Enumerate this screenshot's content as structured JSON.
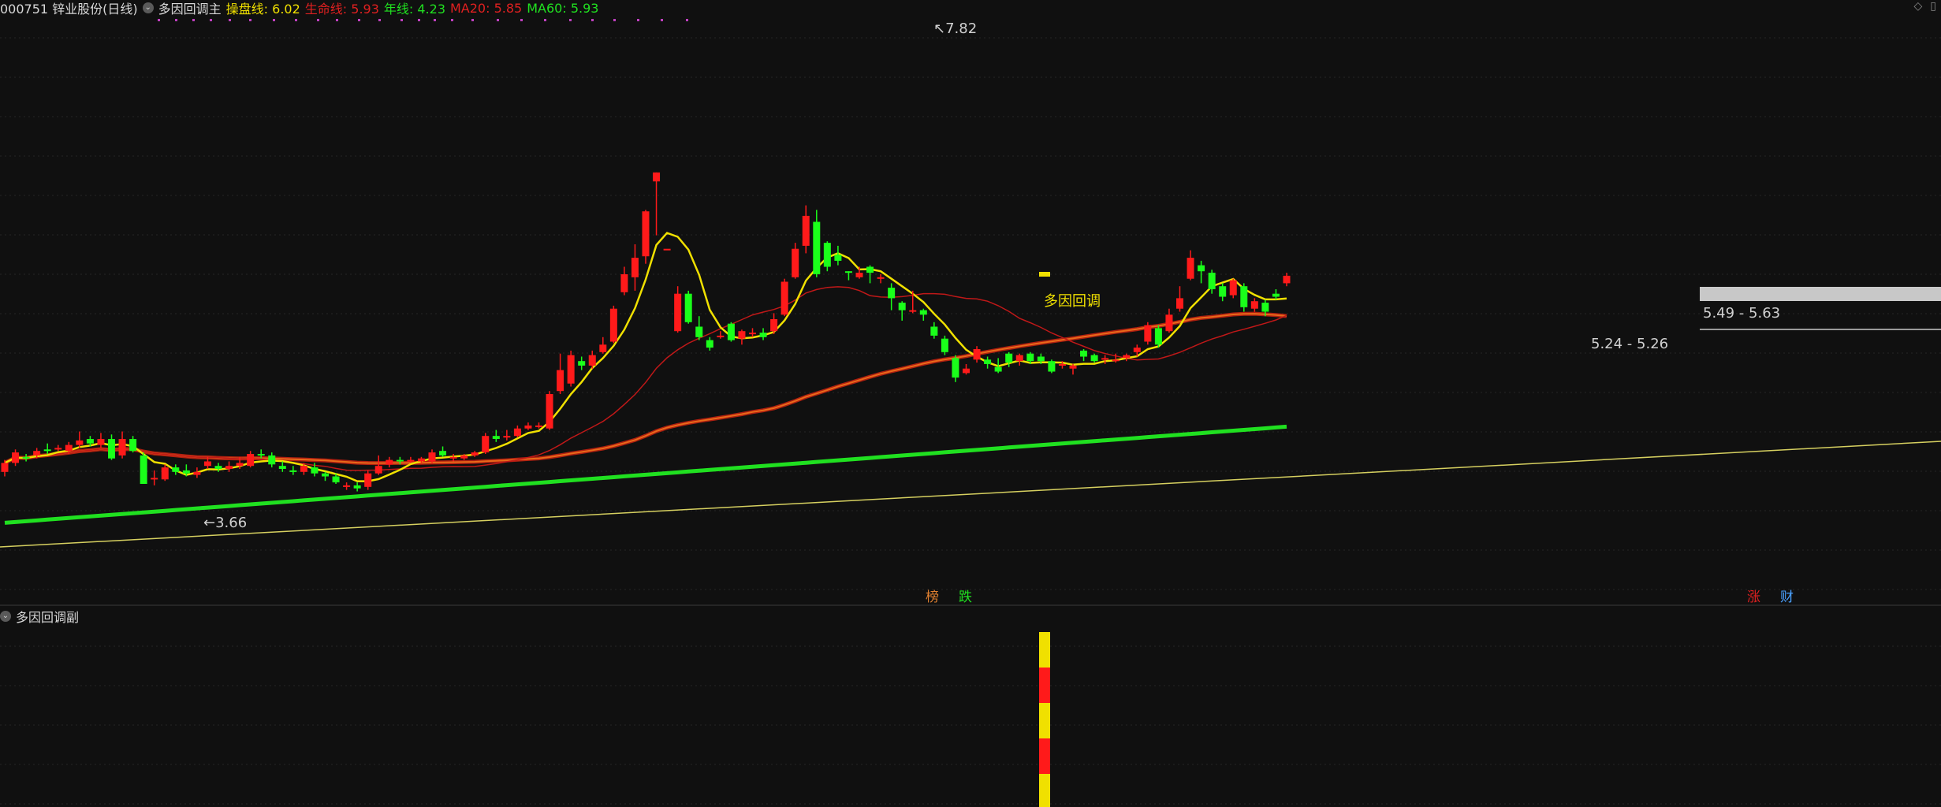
{
  "header": {
    "stock": "000751 锌业股份(日线)",
    "indicator": "多因回调主",
    "items": [
      {
        "label": "操盘线: ",
        "value": "6.02",
        "color": "#f0e000"
      },
      {
        "label": "生命线: ",
        "value": "5.93",
        "color": "#e02020"
      },
      {
        "label": "年线: ",
        "value": "4.23",
        "color": "#20e020"
      },
      {
        "label": "MA20: ",
        "value": "5.85",
        "color": "#e02020"
      },
      {
        "label": "MA60: ",
        "value": "5.93",
        "color": "#20e020"
      }
    ]
  },
  "sub_header": {
    "label": "多因回调副"
  },
  "annotations": {
    "high": "7.82",
    "low": "3.66",
    "signal": "多因回调",
    "zone1": "5.24 - 5.26",
    "zone2": "5.49 - 5.63"
  },
  "markers": [
    {
      "text": "榜",
      "color": "#e08030"
    },
    {
      "text": "跌",
      "color": "#20e020"
    },
    {
      "text": "涨",
      "color": "#e02020"
    },
    {
      "text": "财",
      "color": "#4aa0ff"
    }
  ],
  "colors": {
    "up": "#ff1a1a",
    "down": "#1aff1a",
    "trade_line": "#f0e000",
    "life_line": "#e86a1a",
    "year_line": "#20e020",
    "ma20": "#c01818"
  },
  "chart_data": {
    "type": "candlestick",
    "ylim": [
      3.0,
      8.0
    ],
    "candles": [
      [
        3.82,
        3.94,
        3.98,
        3.76
      ],
      [
        3.94,
        4.08,
        4.12,
        3.9
      ],
      [
        4.02,
        4.0,
        4.06,
        3.96
      ],
      [
        4.04,
        4.1,
        4.14,
        4.0
      ],
      [
        4.12,
        4.1,
        4.2,
        4.06
      ],
      [
        4.12,
        4.14,
        4.18,
        4.1
      ],
      [
        4.1,
        4.18,
        4.22,
        4.06
      ],
      [
        4.18,
        4.24,
        4.36,
        4.14
      ],
      [
        4.26,
        4.2,
        4.3,
        4.16
      ],
      [
        4.18,
        4.26,
        4.34,
        4.14
      ],
      [
        4.26,
        4.0,
        4.32,
        3.98
      ],
      [
        4.04,
        4.26,
        4.36,
        4.0
      ],
      [
        4.26,
        4.1,
        4.3,
        4.08
      ],
      [
        4.04,
        3.66,
        4.08,
        3.66
      ],
      [
        3.74,
        3.74,
        3.84,
        3.64
      ],
      [
        3.72,
        3.88,
        3.92,
        3.7
      ],
      [
        3.88,
        3.82,
        3.92,
        3.78
      ],
      [
        3.84,
        3.8,
        3.92,
        3.76
      ],
      [
        3.78,
        3.82,
        3.88,
        3.74
      ],
      [
        3.9,
        3.96,
        4.02,
        3.86
      ],
      [
        3.9,
        3.86,
        3.94,
        3.82
      ],
      [
        3.86,
        3.9,
        3.96,
        3.82
      ],
      [
        3.9,
        3.94,
        4.02,
        3.86
      ],
      [
        3.9,
        4.06,
        4.1,
        3.88
      ],
      [
        4.06,
        4.04,
        4.12,
        4.0
      ],
      [
        4.04,
        3.92,
        4.08,
        3.88
      ],
      [
        3.9,
        3.86,
        3.96,
        3.82
      ],
      [
        3.84,
        3.82,
        3.9,
        3.78
      ],
      [
        3.82,
        3.9,
        3.94,
        3.78
      ],
      [
        3.88,
        3.8,
        3.94,
        3.76
      ],
      [
        3.8,
        3.76,
        3.82,
        3.7
      ],
      [
        3.76,
        3.68,
        3.8,
        3.66
      ],
      [
        3.62,
        3.64,
        3.68,
        3.58
      ],
      [
        3.64,
        3.6,
        3.68,
        3.56
      ],
      [
        3.62,
        3.8,
        3.84,
        3.58
      ],
      [
        3.8,
        3.9,
        4.04,
        3.78
      ],
      [
        3.92,
        3.98,
        4.02,
        3.88
      ],
      [
        3.98,
        3.96,
        4.02,
        3.92
      ],
      [
        3.96,
        3.98,
        4.02,
        3.94
      ],
      [
        3.96,
        4.0,
        4.02,
        3.94
      ],
      [
        3.96,
        4.08,
        4.12,
        3.94
      ],
      [
        4.1,
        4.04,
        4.16,
        4.02
      ],
      [
        4.0,
        4.02,
        4.06,
        3.96
      ],
      [
        4.0,
        4.04,
        4.06,
        3.98
      ],
      [
        4.04,
        4.08,
        4.1,
        4.02
      ],
      [
        4.08,
        4.3,
        4.34,
        4.06
      ],
      [
        4.3,
        4.26,
        4.38,
        4.22
      ],
      [
        4.3,
        4.3,
        4.38,
        4.24
      ],
      [
        4.3,
        4.4,
        4.44,
        4.28
      ],
      [
        4.4,
        4.44,
        4.48,
        4.38
      ],
      [
        4.44,
        4.44,
        4.48,
        4.4
      ],
      [
        4.4,
        4.86,
        4.9,
        4.38
      ],
      [
        4.9,
        5.18,
        5.4,
        4.86
      ],
      [
        5.0,
        5.38,
        5.44,
        4.96
      ],
      [
        5.3,
        5.24,
        5.36,
        5.18
      ],
      [
        5.24,
        5.38,
        5.44,
        5.2
      ],
      [
        5.42,
        5.52,
        5.62,
        5.4
      ],
      [
        5.56,
        6.0,
        6.04,
        5.54
      ],
      [
        6.22,
        6.46,
        6.56,
        6.18
      ],
      [
        6.42,
        6.68,
        6.86,
        6.24
      ],
      [
        6.7,
        7.3,
        7.32,
        6.6
      ],
      [
        7.7,
        7.82,
        7.82,
        6.98
      ],
      [
        6.8,
        6.8,
        6.8,
        6.8
      ],
      [
        5.7,
        6.2,
        6.3,
        5.68
      ],
      [
        6.2,
        5.82,
        6.24,
        5.8
      ],
      [
        5.76,
        5.62,
        5.9,
        5.58
      ],
      [
        5.58,
        5.48,
        5.62,
        5.44
      ],
      [
        5.64,
        5.64,
        5.7,
        5.6
      ],
      [
        5.8,
        5.58,
        5.82,
        5.56
      ],
      [
        5.6,
        5.7,
        5.72,
        5.52
      ],
      [
        5.66,
        5.68,
        5.74,
        5.62
      ],
      [
        5.68,
        5.62,
        5.74,
        5.58
      ],
      [
        5.7,
        5.86,
        5.94,
        5.66
      ],
      [
        5.92,
        6.36,
        6.4,
        5.9
      ],
      [
        6.42,
        6.8,
        6.88,
        6.4
      ],
      [
        6.84,
        7.24,
        7.38,
        6.74
      ],
      [
        7.16,
        6.46,
        7.32,
        6.42
      ],
      [
        6.88,
        6.56,
        6.9,
        6.5
      ],
      [
        6.72,
        6.64,
        6.84,
        6.58
      ],
      [
        6.5,
        6.48,
        6.5,
        6.38
      ],
      [
        6.42,
        6.48,
        6.56,
        6.4
      ],
      [
        6.56,
        6.48,
        6.58,
        6.34
      ],
      [
        6.4,
        6.42,
        6.46,
        6.34
      ],
      [
        6.28,
        6.14,
        6.34,
        5.98
      ],
      [
        6.08,
        5.98,
        6.1,
        5.84
      ],
      [
        5.98,
        5.98,
        6.24,
        5.94
      ],
      [
        5.98,
        5.92,
        6.0,
        5.84
      ],
      [
        5.76,
        5.64,
        5.82,
        5.6
      ],
      [
        5.6,
        5.42,
        5.64,
        5.38
      ],
      [
        5.34,
        5.08,
        5.38,
        5.02
      ],
      [
        5.14,
        5.2,
        5.26,
        5.12
      ],
      [
        5.32,
        5.46,
        5.5,
        5.28
      ],
      [
        5.32,
        5.26,
        5.36,
        5.2
      ],
      [
        5.22,
        5.16,
        5.34,
        5.14
      ],
      [
        5.4,
        5.28,
        5.42,
        5.22
      ],
      [
        5.3,
        5.38,
        5.4,
        5.24
      ],
      [
        5.4,
        5.3,
        5.42,
        5.26
      ],
      [
        5.36,
        5.3,
        5.4,
        5.26
      ],
      [
        5.3,
        5.16,
        5.32,
        5.14
      ],
      [
        5.24,
        5.26,
        5.3,
        5.2
      ],
      [
        5.2,
        5.24,
        5.26,
        5.12
      ],
      [
        5.44,
        5.36,
        5.46,
        5.3
      ],
      [
        5.38,
        5.3,
        5.4,
        5.28
      ],
      [
        5.32,
        5.34,
        5.38,
        5.26
      ],
      [
        5.3,
        5.32,
        5.4,
        5.28
      ],
      [
        5.34,
        5.38,
        5.4,
        5.3
      ],
      [
        5.42,
        5.48,
        5.52,
        5.36
      ],
      [
        5.56,
        5.78,
        5.82,
        5.52
      ],
      [
        5.74,
        5.52,
        5.78,
        5.48
      ],
      [
        5.7,
        5.92,
        6.0,
        5.68
      ],
      [
        6.0,
        6.14,
        6.3,
        5.96
      ],
      [
        6.4,
        6.68,
        6.78,
        6.38
      ],
      [
        6.58,
        6.5,
        6.64,
        6.34
      ],
      [
        6.48,
        6.26,
        6.52,
        6.2
      ],
      [
        6.3,
        6.16,
        6.34,
        6.1
      ],
      [
        6.18,
        6.38,
        6.4,
        6.14
      ],
      [
        6.3,
        6.02,
        6.34,
        5.96
      ],
      [
        6.0,
        6.1,
        6.14,
        5.96
      ],
      [
        6.08,
        5.96,
        6.12,
        5.9
      ],
      [
        6.2,
        6.16,
        6.26,
        6.12
      ],
      [
        6.34,
        6.44,
        6.48,
        6.3
      ]
    ]
  }
}
